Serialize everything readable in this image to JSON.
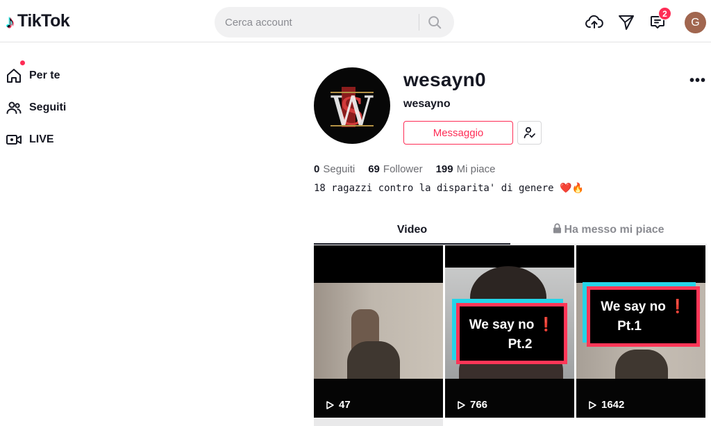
{
  "header": {
    "brand": "TikTok",
    "search_placeholder": "Cerca account",
    "inbox_badge": "2",
    "user_initial": "G"
  },
  "sidebar": {
    "items": [
      {
        "label": "Per te",
        "icon": "home-icon"
      },
      {
        "label": "Seguiti",
        "icon": "people-icon"
      },
      {
        "label": "LIVE",
        "icon": "live-video-icon"
      }
    ]
  },
  "profile": {
    "username": "wesayn0",
    "nickname": "wesayno",
    "message_button": "Messaggio",
    "stats": [
      {
        "value": "0",
        "label": "Seguiti"
      },
      {
        "value": "69",
        "label": "Follower"
      },
      {
        "value": "199",
        "label": "Mi piace"
      }
    ],
    "bio": "18 ragazzi contro la disparita' di genere ❤️🔥"
  },
  "tabs": {
    "video": "Video",
    "liked": "Ha messo mi piace"
  },
  "videos": [
    {
      "views": "47"
    },
    {
      "views": "766",
      "title_line1": "We say no",
      "title_line2": "Pt.2"
    },
    {
      "views": "1642",
      "title_line1": "We say no",
      "title_line2": "Pt.1"
    }
  ],
  "colors": {
    "accent": "#fe2c55",
    "text": "#161823",
    "muted": "#8a8b91"
  }
}
